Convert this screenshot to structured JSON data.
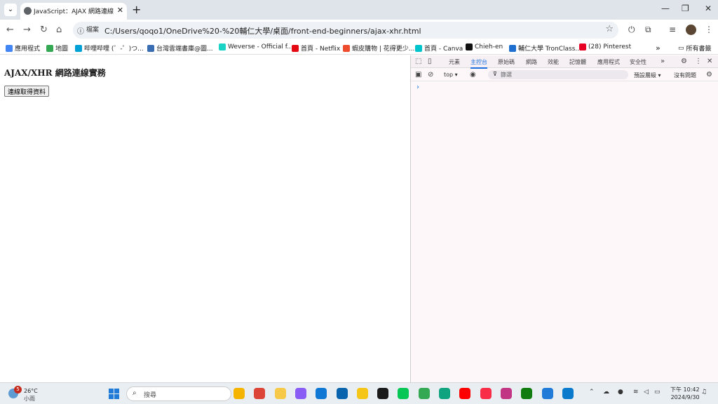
{
  "browser": {
    "tab_title": "JavaScript：AJAX 網路連線實務",
    "new_tab": "+",
    "omnibox_chip": "檔案",
    "url": "C:/Users/qoqo1/OneDrive%20-%20輔仁大學/桌面/front-end-beginners/ajax-xhr.html",
    "bookmarks": [
      {
        "label": "應用程式",
        "color": "#4285f4"
      },
      {
        "label": "地圖",
        "color": "#34a853"
      },
      {
        "label": "哔哩哔哩 (゜-゜)つ...",
        "color": "#00a1d6"
      },
      {
        "label": "台灣雲端書庫@圖...",
        "color": "#3b6db3"
      },
      {
        "label": "Weverse - Official f...",
        "color": "#19d3c5"
      },
      {
        "label": "首頁 - Netflix",
        "color": "#e50914"
      },
      {
        "label": "蝦皮購物 | 花得更少...",
        "color": "#ee4d2d"
      },
      {
        "label": "首頁 - Canva",
        "color": "#00c4cc"
      },
      {
        "label": "Chieh-en",
        "color": "#111111"
      },
      {
        "label": "輔仁大學 TronClass...",
        "color": "#1e6fd0"
      },
      {
        "label": "(28) Pinterest",
        "color": "#e60023"
      }
    ],
    "more_bookmarks": "»",
    "all_bookmarks": "所有書籤"
  },
  "page": {
    "heading": "AJAX/XHR 網路連線實務",
    "button_label": "連線取得資料"
  },
  "devtools": {
    "tabs": [
      "元素",
      "主控台",
      "原始碼",
      "網路",
      "效能",
      "記憶體",
      "應用程式",
      "安全性"
    ],
    "active_tab": "主控台",
    "more": "»",
    "context": "top ▾",
    "filter_placeholder": "篩選",
    "levels": "預設層級 ▾",
    "issues": "沒有問題",
    "prompt": "›"
  },
  "taskbar": {
    "weather_temp": "26°C",
    "weather_desc": "小雨",
    "weather_badge": "5",
    "search_placeholder": "搜尋",
    "time": "下午 10:42",
    "date": "2024/9/30",
    "apps": [
      {
        "name": "file-explorer-icon",
        "color": "#f4b400"
      },
      {
        "name": "chrome-icon",
        "color": "#db4437"
      },
      {
        "name": "folder-icon",
        "color": "#f7c948"
      },
      {
        "name": "copilot-icon",
        "color": "#8a5cf6"
      },
      {
        "name": "edge-icon",
        "color": "#0f78d4"
      },
      {
        "name": "outlook-icon",
        "color": "#0a64ad"
      },
      {
        "name": "notes-icon",
        "color": "#f5c518"
      },
      {
        "name": "sticky-icon",
        "color": "#1a1a1a"
      },
      {
        "name": "line-icon",
        "color": "#06c755"
      },
      {
        "name": "drive-icon",
        "color": "#34a853"
      },
      {
        "name": "chatgpt-icon",
        "color": "#10a37f"
      },
      {
        "name": "youtube-icon",
        "color": "#ff0000"
      },
      {
        "name": "music-icon",
        "color": "#fa2d48"
      },
      {
        "name": "instagram-icon",
        "color": "#c13584"
      },
      {
        "name": "xbox-icon",
        "color": "#107c10"
      },
      {
        "name": "shark-icon",
        "color": "#1f7ad8"
      },
      {
        "name": "vscode-icon",
        "color": "#0a7acc"
      }
    ]
  }
}
